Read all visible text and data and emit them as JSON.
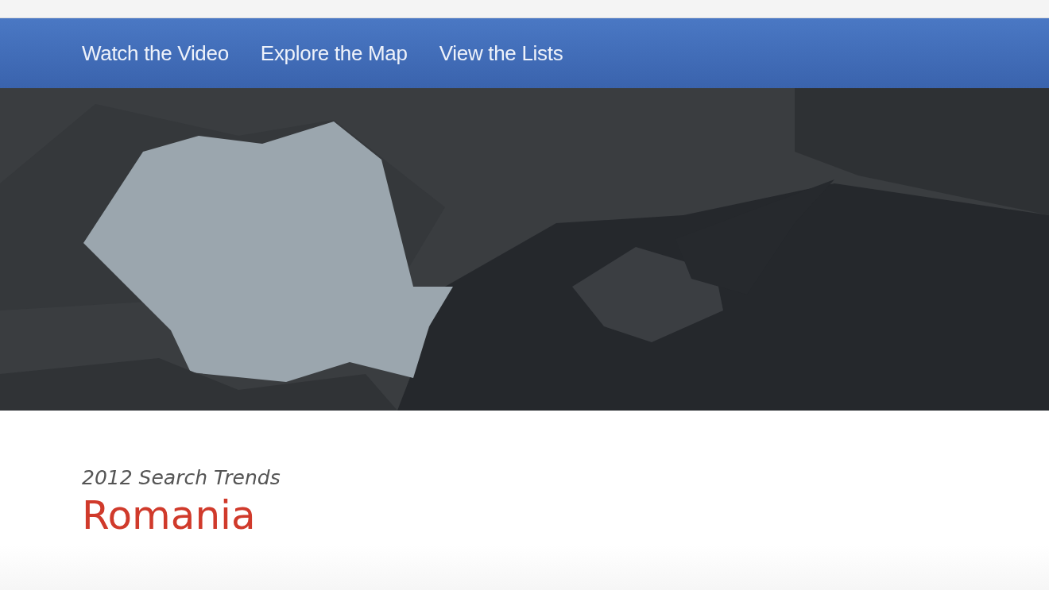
{
  "nav": {
    "links": [
      {
        "label": "Watch the Video"
      },
      {
        "label": "Explore the Map"
      },
      {
        "label": "View the Lists"
      }
    ]
  },
  "heading": {
    "subtitle": "2012 Search Trends",
    "title": "Romania"
  }
}
